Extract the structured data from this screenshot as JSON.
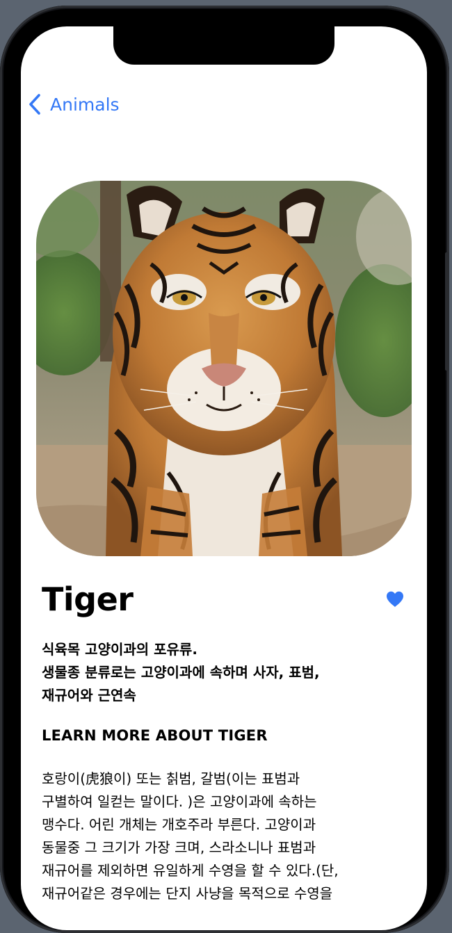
{
  "nav": {
    "back_label": "Animals",
    "back_icon": "chevron-left-icon"
  },
  "hero": {
    "image_subject": "tiger",
    "image_alt": "Tiger"
  },
  "detail": {
    "title": "Tiger",
    "favorite_icon": "heart-icon",
    "favorite_color": "#3478f6",
    "summary_lines": [
      "식육목 고양이과의 포유류.",
      "생물종 분류로는 고양이과에 속하며 사자, 표범,",
      "재규어와 근연속"
    ],
    "learn_more_heading": "LEARN MORE ABOUT TIGER",
    "description_lines": [
      "호랑이(虎狼이) 또는 칡범, 갈범(이는 표범과",
      "구별하여 일컫는 말이다. )은 고양이과에 속하는",
      "맹수다. 어린 개체는 개호주라 부른다. 고양이과",
      "동물중 그 크기가 가장 크며, 스라소니나 표범과",
      "재규어를 제외하면 유일하게 수영을 할 수 있다.(단,",
      "재규어같은 경우에는 단지 사냥을 목적으로 수영을"
    ]
  },
  "colors": {
    "accent": "#3478f6",
    "background": "#ffffff",
    "text": "#000000"
  }
}
